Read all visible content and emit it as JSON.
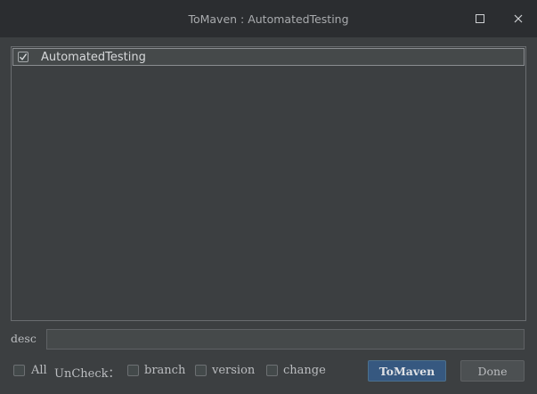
{
  "window": {
    "title": "ToMaven : AutomatedTesting",
    "maximize_icon": "maximize-icon",
    "close_icon": "close-icon"
  },
  "list": {
    "items": [
      {
        "label": "AutomatedTesting",
        "checked": true
      }
    ]
  },
  "desc": {
    "label": "desc",
    "value": ""
  },
  "options": {
    "all_label": "All",
    "uncheck_label": "UnCheck：",
    "branch_label": "branch",
    "version_label": "version",
    "change_label": "change",
    "all_checked": false,
    "branch_checked": false,
    "version_checked": false,
    "change_checked": false
  },
  "buttons": {
    "tomaven_label": "ToMaven",
    "done_label": "Done"
  },
  "colors": {
    "background": "#3c3f41",
    "titlebar": "#2b2d30",
    "primary_button": "#365880"
  }
}
